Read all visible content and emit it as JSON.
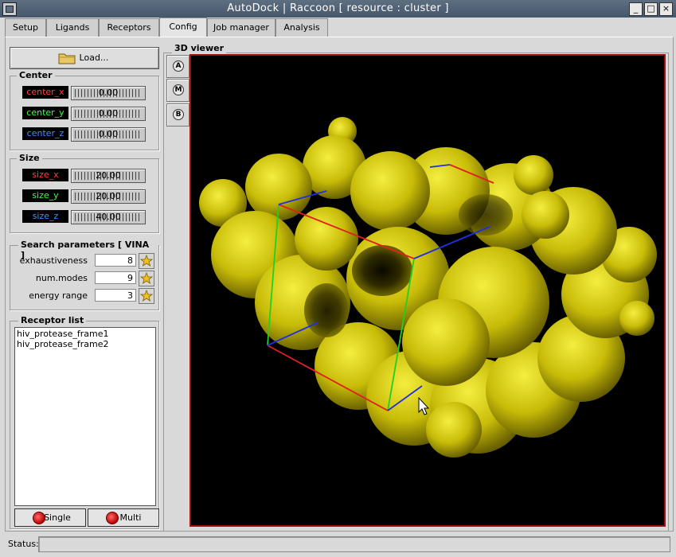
{
  "window": {
    "title": "AutoDock | Raccoon      [ resource : cluster ]",
    "controls": [
      "_",
      "□",
      "×"
    ]
  },
  "tabs": [
    {
      "label": "Setup"
    },
    {
      "label": "Ligands"
    },
    {
      "label": "Receptors"
    },
    {
      "label": "Config",
      "active": true
    },
    {
      "label": "Job manager"
    },
    {
      "label": "Analysis"
    }
  ],
  "load_button": {
    "label": "Load...",
    "icon": "folder-icon"
  },
  "center": {
    "title": "Center",
    "items": [
      {
        "label": "center_x",
        "value": "0.00",
        "color": "#ff4040"
      },
      {
        "label": "center_y",
        "value": "0.00",
        "color": "#40ff40"
      },
      {
        "label": "center_z",
        "value": "0.00",
        "color": "#4090ff"
      }
    ]
  },
  "size": {
    "title": "Size",
    "items": [
      {
        "label": "size_x",
        "value": "20.00",
        "color": "#ff4040"
      },
      {
        "label": "size_y",
        "value": "20.00",
        "color": "#40ff40"
      },
      {
        "label": "size_z",
        "value": "40.00",
        "color": "#4090ff"
      }
    ]
  },
  "search": {
    "title": "Search parameters [ VINA ]",
    "params": [
      {
        "label": "exhaustiveness",
        "value": "8"
      },
      {
        "label": "num.modes",
        "value": "9"
      },
      {
        "label": "energy range",
        "value": "3"
      }
    ]
  },
  "receptor_list": {
    "title": "Receptor list",
    "items": [
      "hiv_protease_frame1",
      "hiv_protease_frame2"
    ],
    "buttons": [
      "Single",
      "Multi"
    ]
  },
  "viewer": {
    "title": "3D viewer",
    "buttons": [
      "A",
      "M",
      "B"
    ],
    "background": "#000000",
    "surface_color": "#d8cf10",
    "border_color": "#a01010"
  },
  "status": {
    "label": "Status:",
    "value": ""
  }
}
